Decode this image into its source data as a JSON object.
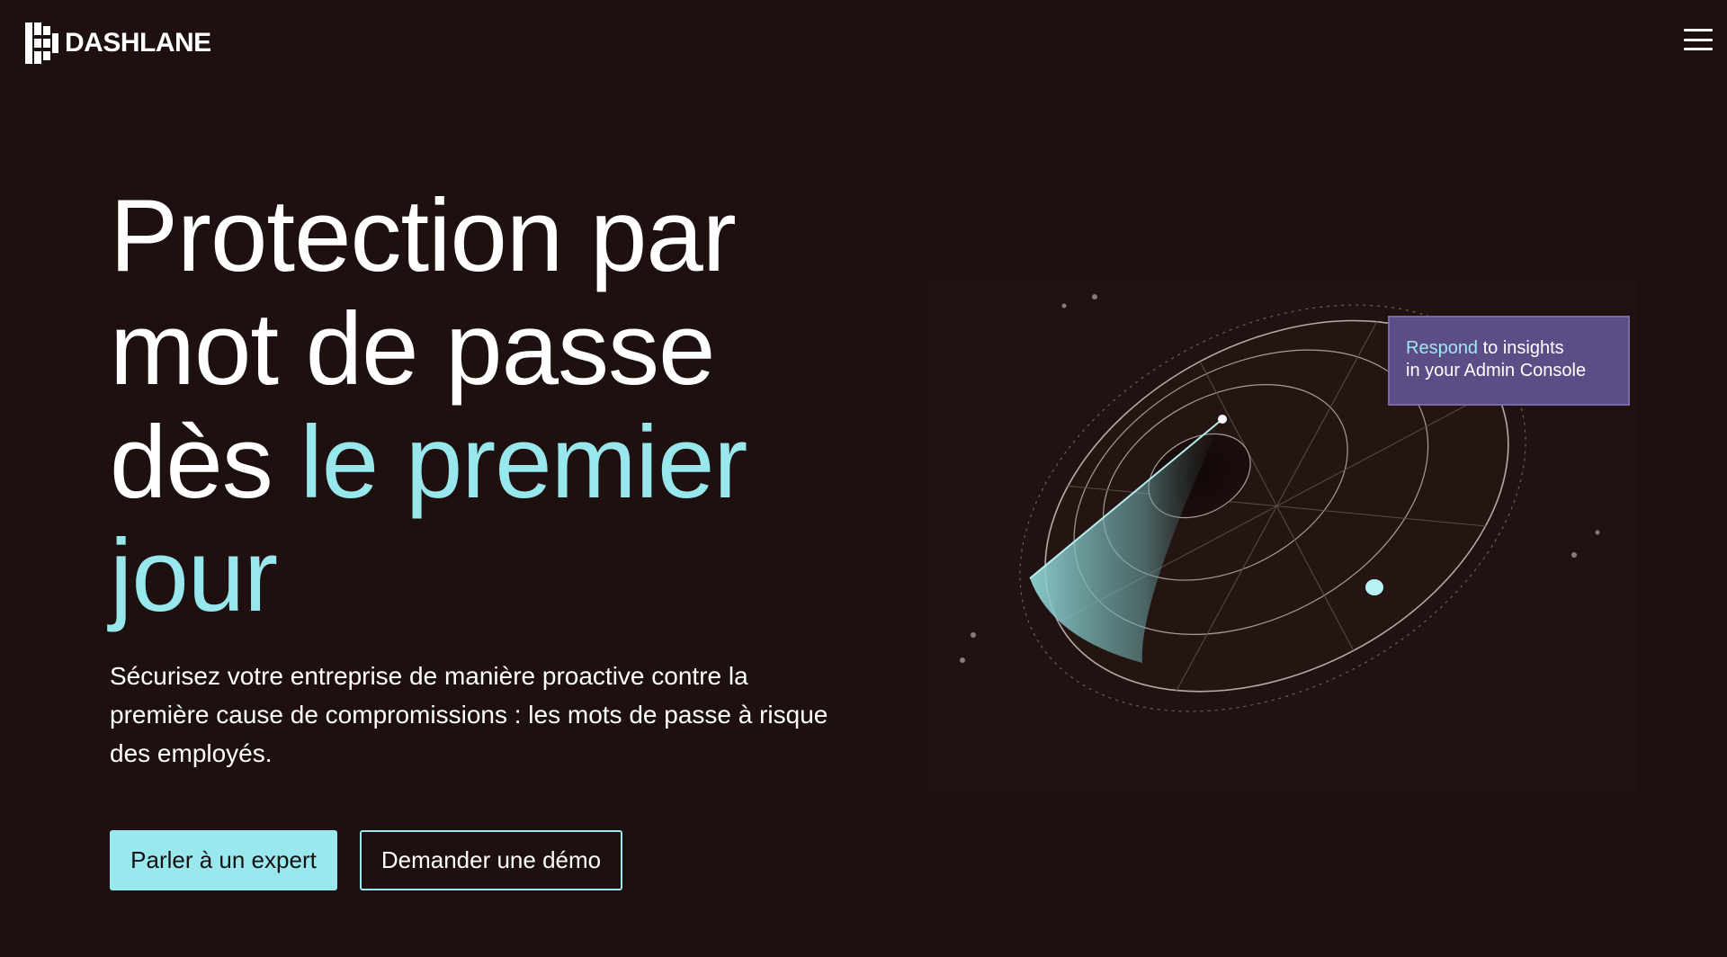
{
  "header": {
    "logo_text": "DASHLANE",
    "menu_icon": "hamburger-menu-icon"
  },
  "hero": {
    "title_part1": "Protection par mot de passe dès ",
    "title_accent": "le premier jour",
    "subtitle": "Sécurisez votre entreprise de manière proactive contre la première cause de compromissions : les mots de passe à risque des employés.",
    "primary_button": "Parler à un expert",
    "secondary_button": "Demander une démo"
  },
  "illustration": {
    "tooltip_accent": "Respond",
    "tooltip_rest_line1": " to insights",
    "tooltip_line2": "in your Admin Console"
  },
  "colors": {
    "background": "#1d100f",
    "accent": "#98e7ec",
    "tooltip_bg": "#5c4d86"
  }
}
